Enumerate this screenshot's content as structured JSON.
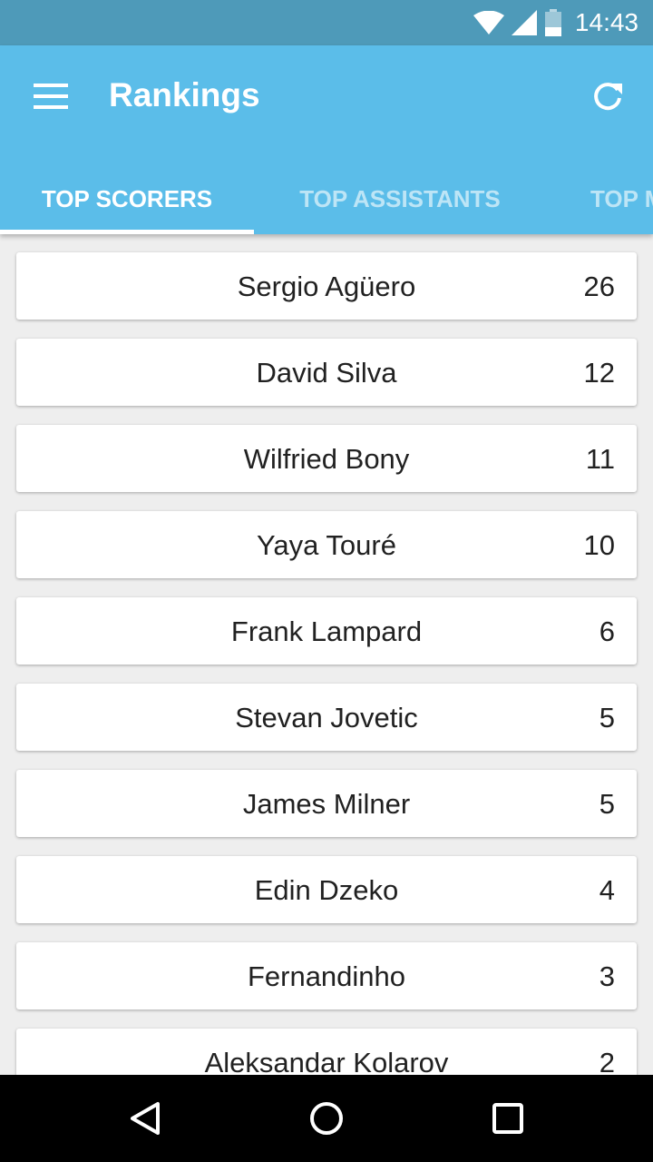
{
  "status_bar": {
    "time": "14:43",
    "icons": [
      "wifi-icon",
      "signal-icon",
      "battery-icon"
    ]
  },
  "app_bar": {
    "title": "Rankings",
    "menu_icon": "hamburger-menu-icon",
    "refresh_icon": "refresh-icon",
    "color": "#5bbde9"
  },
  "tabs": [
    {
      "label": "TOP SCORERS",
      "active": true
    },
    {
      "label": "TOP ASSISTANTS",
      "active": false
    },
    {
      "label": "TOP M",
      "active": false
    }
  ],
  "rankings": [
    {
      "name": "Sergio Agüero",
      "goals": "26"
    },
    {
      "name": "David Silva",
      "goals": "12"
    },
    {
      "name": "Wilfried Bony",
      "goals": "11"
    },
    {
      "name": "Yaya Touré",
      "goals": "10"
    },
    {
      "name": "Frank Lampard",
      "goals": "6"
    },
    {
      "name": "Stevan Jovetic",
      "goals": "5"
    },
    {
      "name": "James Milner",
      "goals": "5"
    },
    {
      "name": "Edin Dzeko",
      "goals": "4"
    },
    {
      "name": "Fernandinho",
      "goals": "3"
    },
    {
      "name": "Aleksandar Kolarov",
      "goals": "2"
    }
  ],
  "nav_bar": {
    "icons": [
      "back-icon",
      "home-icon",
      "recents-icon"
    ]
  }
}
